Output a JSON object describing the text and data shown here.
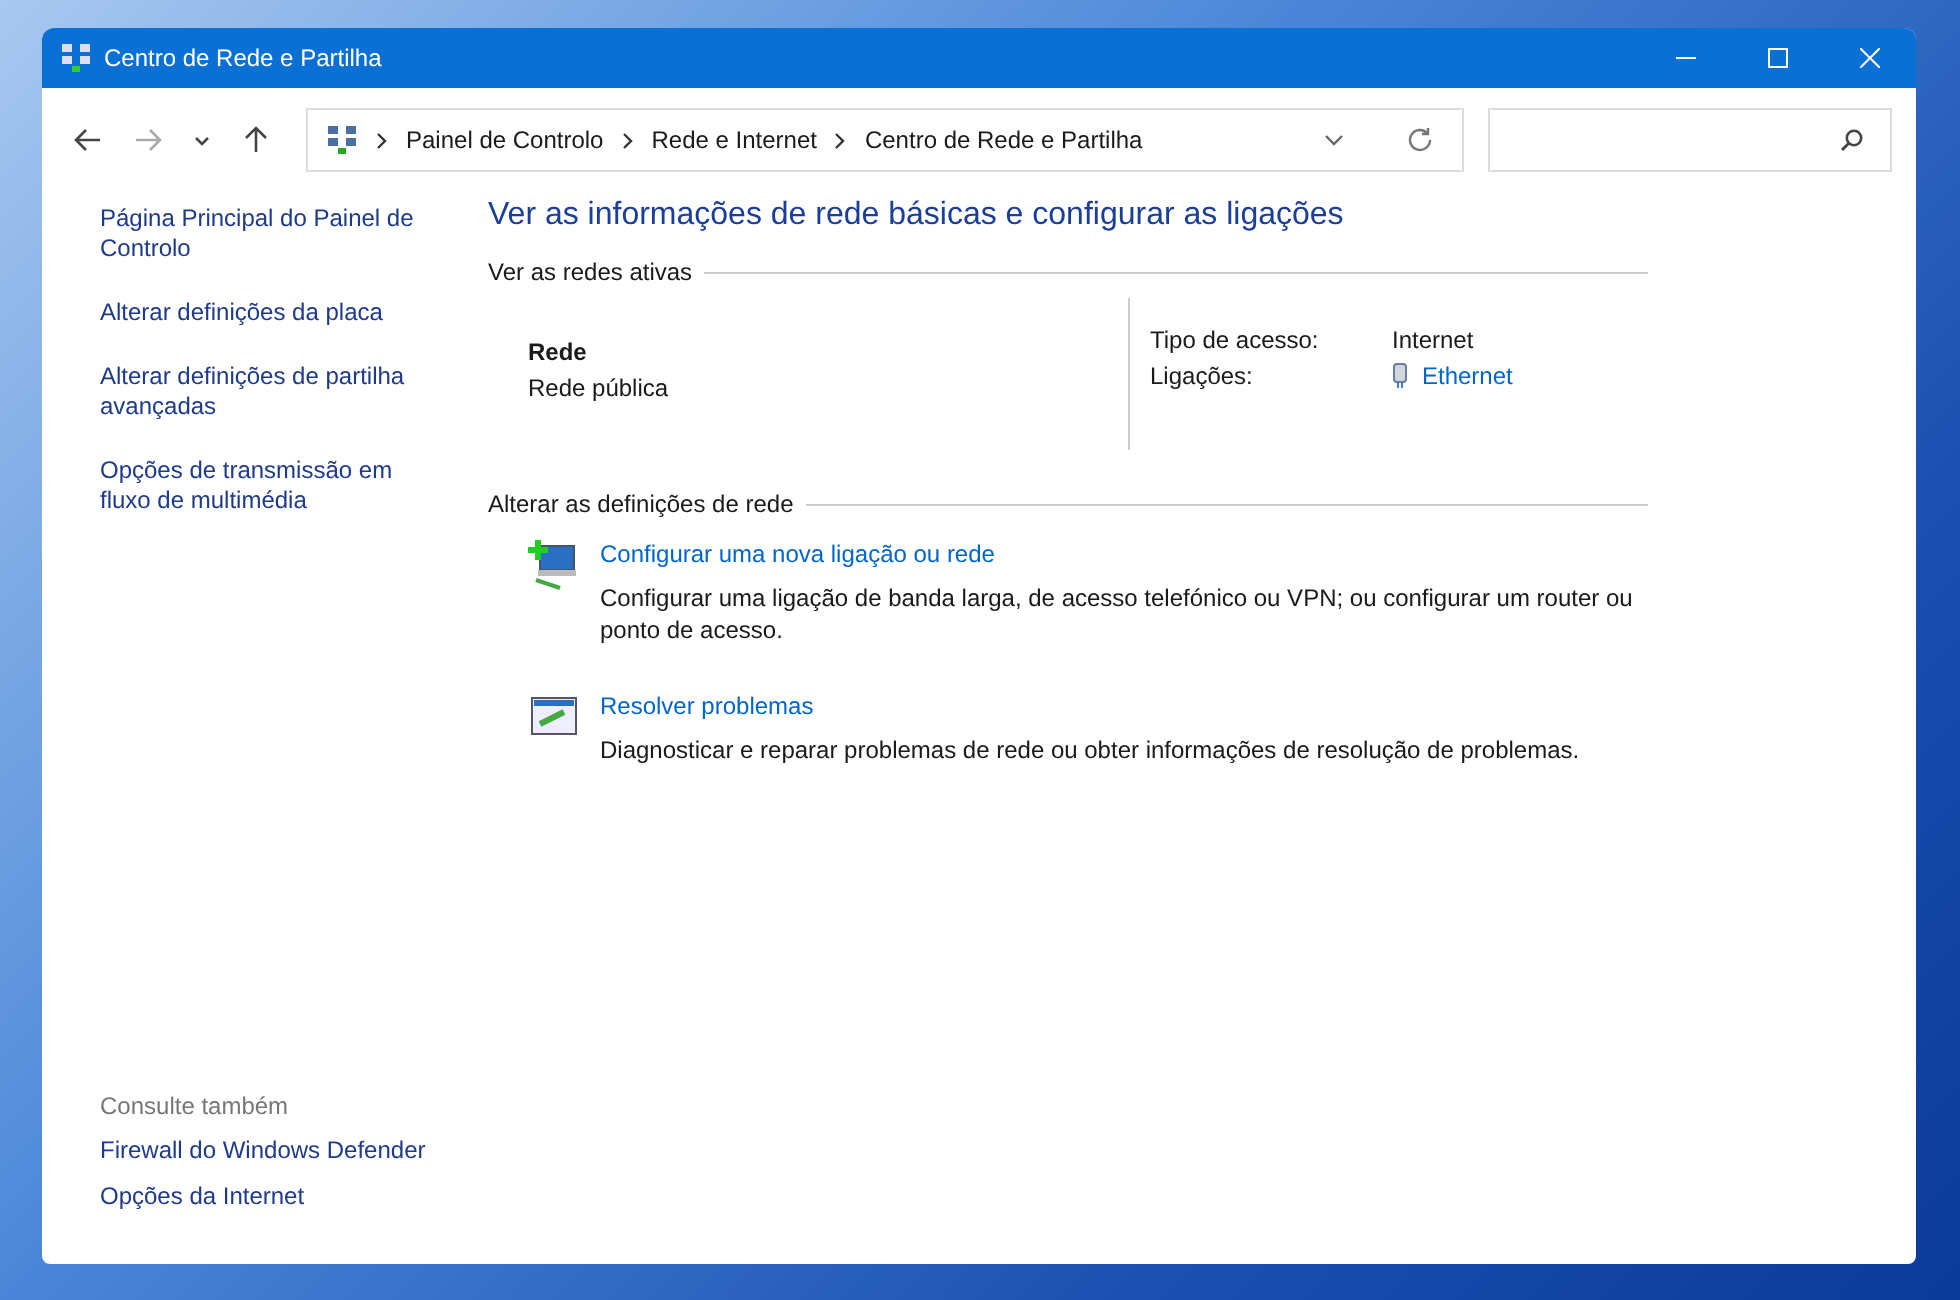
{
  "window": {
    "title": "Centro de Rede e Partilha"
  },
  "nav_buttons": [
    {
      "kind": "back",
      "disabled": false
    },
    {
      "kind": "forward",
      "disabled": true
    },
    {
      "kind": "recent",
      "disabled": false
    },
    {
      "kind": "up",
      "disabled": false
    }
  ],
  "address_bar": {
    "crumbs": [
      "Painel de Controlo",
      "Rede e Internet",
      "Centro de Rede e Partilha"
    ]
  },
  "sidebar": {
    "items": [
      "Página Principal do Painel de Controlo",
      "Alterar definições da placa",
      "Alterar definições de partilha avançadas",
      "Opções de transmissão em fluxo de multimédia"
    ],
    "see_also": {
      "heading": "Consulte também",
      "items": [
        "Firewall do Windows Defender",
        "Opções da Internet"
      ]
    }
  },
  "main": {
    "title": "Ver as informações de rede básicas e configurar as ligações",
    "active_networks": {
      "heading": "Ver as redes ativas",
      "name": "Rede",
      "profile": "Rede pública",
      "access_label": "Tipo de acesso:",
      "access_value": "Internet",
      "connections_label": "Ligações:",
      "connection": "Ethernet"
    },
    "change_settings": {
      "heading": "Alterar as definições de rede",
      "tasks": [
        {
          "kind": "new-connection",
          "link": "Configurar uma nova ligação ou rede",
          "description": "Configurar uma ligação de banda larga, de acesso telefónico ou VPN; ou configurar um router ou ponto de acesso."
        },
        {
          "kind": "troubleshoot",
          "link": "Resolver problemas",
          "description": "Diagnosticar e reparar problemas de rede ou obter informações de resolução de problemas."
        }
      ]
    }
  }
}
